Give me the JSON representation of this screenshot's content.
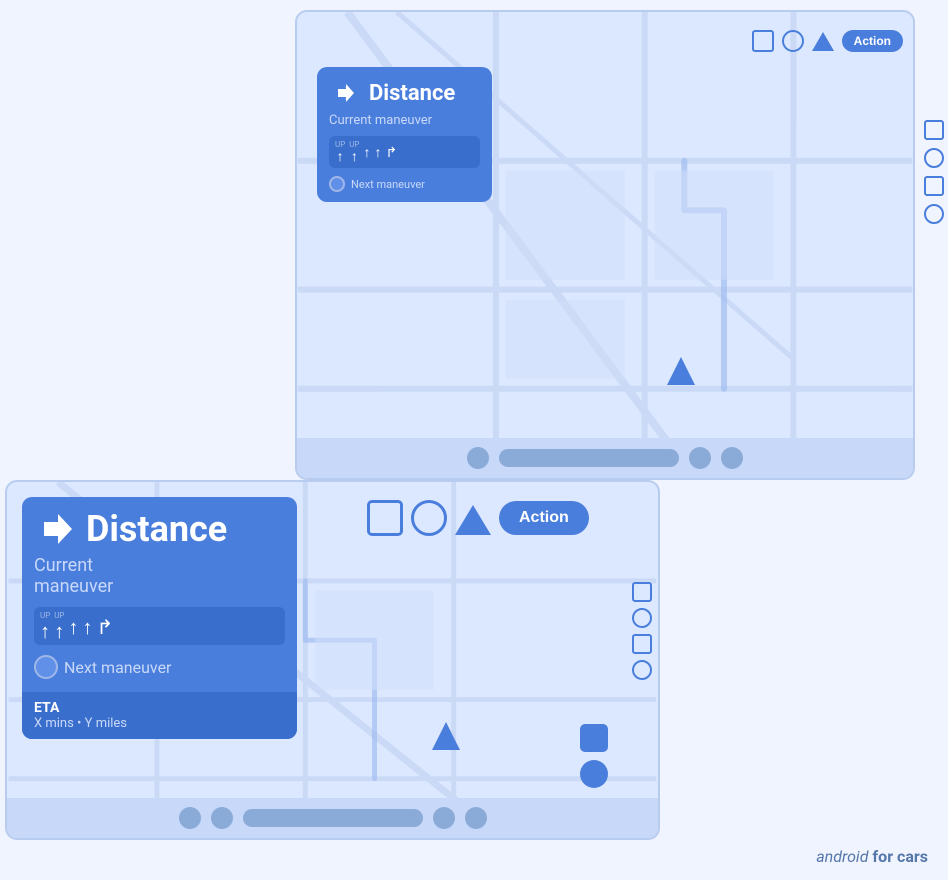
{
  "small_screen": {
    "nav_card": {
      "title": "Distance",
      "subtitle": "Current maneuver",
      "lane_items": [
        {
          "label": "UP",
          "arrow": "↑"
        },
        {
          "label": "UP",
          "arrow": "↑"
        },
        {
          "label": "",
          "arrow": "↑"
        },
        {
          "label": "",
          "arrow": "↑"
        },
        {
          "label": "",
          "arrow": "↱"
        }
      ],
      "next_maneuver": "Next maneuver"
    },
    "action_bar": {
      "action_label": "Action"
    }
  },
  "large_screen": {
    "nav_card": {
      "title": "Distance",
      "subtitle_line1": "Current",
      "subtitle_line2": "maneuver",
      "lane_items": [
        {
          "label": "UP",
          "arrow": "↑"
        },
        {
          "label": "UP",
          "arrow": "↑"
        },
        {
          "label": "",
          "arrow": "↑"
        },
        {
          "label": "",
          "arrow": "↑"
        },
        {
          "label": "",
          "arrow": "↱"
        }
      ],
      "next_maneuver": "Next maneuver",
      "eta_label": "ETA",
      "eta_value": "X mins • Y miles"
    },
    "action_bar": {
      "action_label": "Action"
    }
  },
  "android_cars_label": {
    "prefix": "android",
    "suffix": " for cars"
  }
}
